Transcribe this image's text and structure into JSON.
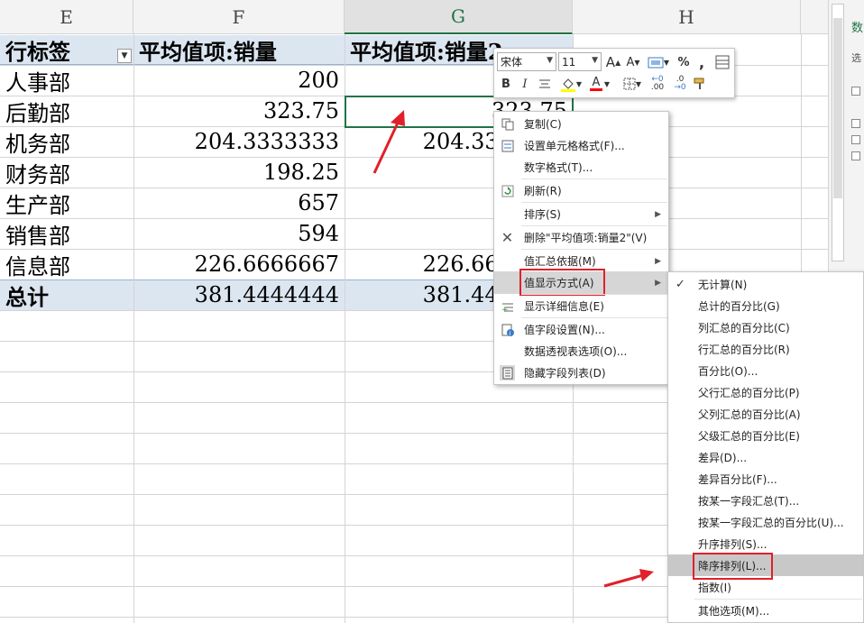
{
  "sheet": {
    "columns": [
      "E",
      "F",
      "G",
      "H"
    ],
    "selected_column": "G",
    "pivot": {
      "header": {
        "row_label": "行标签",
        "col_f": "平均值项:销量",
        "col_g": "平均值项:销量2"
      },
      "rows": [
        {
          "label": "人事部",
          "f": "200",
          "g": ""
        },
        {
          "label": "后勤部",
          "f": "323.75",
          "g": "323.75"
        },
        {
          "label": "机务部",
          "f": "204.3333333",
          "g": "204.3333333"
        },
        {
          "label": "财务部",
          "f": "198.25",
          "g": ""
        },
        {
          "label": "生产部",
          "f": "657",
          "g": ""
        },
        {
          "label": "销售部",
          "f": "594",
          "g": ""
        },
        {
          "label": "信息部",
          "f": "226.6666667",
          "g": "226.6666667"
        }
      ],
      "total": {
        "label": "总计",
        "f": "381.4444444",
        "g": "381.4444444"
      }
    }
  },
  "mini_toolbar": {
    "font_name": "宋体",
    "font_size": "11",
    "buttons": {
      "grow": "A",
      "shrink": "A",
      "percent": "%",
      "comma": ",",
      "bold": "B",
      "italic": "I",
      "font_color_letter": "A",
      "inc_decimal": ".00",
      "dec_decimal": ".0"
    },
    "colors": {
      "highlight": "#ffff00",
      "font_color": "#ff0000"
    }
  },
  "context_menu": {
    "items": [
      {
        "label": "复制(C)",
        "icon": "copy-icon",
        "arrow": false
      },
      {
        "label": "设置单元格格式(F)...",
        "icon": "format-cells-icon",
        "arrow": false
      },
      {
        "label": "数字格式(T)...",
        "icon": "",
        "arrow": false
      },
      {
        "label": "刷新(R)",
        "icon": "refresh-icon",
        "arrow": false
      },
      {
        "label": "排序(S)",
        "icon": "",
        "arrow": true
      },
      {
        "label": "删除\"平均值项:销量2\"(V)",
        "icon": "delete-x-icon",
        "arrow": false
      },
      {
        "label": "值汇总依据(M)",
        "icon": "",
        "arrow": true
      },
      {
        "label": "值显示方式(A)",
        "icon": "",
        "arrow": true,
        "highlighted": true
      },
      {
        "label": "显示详细信息(E)",
        "icon": "show-details-icon",
        "arrow": false
      },
      {
        "label": "值字段设置(N)...",
        "icon": "field-settings-icon",
        "arrow": false
      },
      {
        "label": "数据透视表选项(O)...",
        "icon": "",
        "arrow": false
      },
      {
        "label": "隐藏字段列表(D)",
        "icon": "field-list-icon",
        "arrow": false
      }
    ],
    "arrow_glyph": "▶"
  },
  "submenu": {
    "check_glyph": "✓",
    "items": [
      {
        "label": "无计算(N)",
        "checked": true
      },
      {
        "label": "总计的百分比(G)"
      },
      {
        "label": "列汇总的百分比(C)"
      },
      {
        "label": "行汇总的百分比(R)"
      },
      {
        "label": "百分比(O)..."
      },
      {
        "label": "父行汇总的百分比(P)"
      },
      {
        "label": "父列汇总的百分比(A)"
      },
      {
        "label": "父级汇总的百分比(E)"
      },
      {
        "label": "差异(D)..."
      },
      {
        "label": "差异百分比(F)..."
      },
      {
        "label": "按某一字段汇总(T)..."
      },
      {
        "label": "按某一字段汇总的百分比(U)..."
      },
      {
        "label": "升序排列(S)..."
      },
      {
        "label": "降序排列(L)...",
        "highlighted": true
      },
      {
        "label": "指数(I)"
      },
      {
        "label": "其他选项(M)..."
      }
    ]
  },
  "right_panel": {
    "chars": [
      "数",
      "选"
    ]
  },
  "accent_colors": {
    "excel_green": "#217346",
    "annotation_red": "#e0202a",
    "pivot_band": "#dce6f1"
  }
}
